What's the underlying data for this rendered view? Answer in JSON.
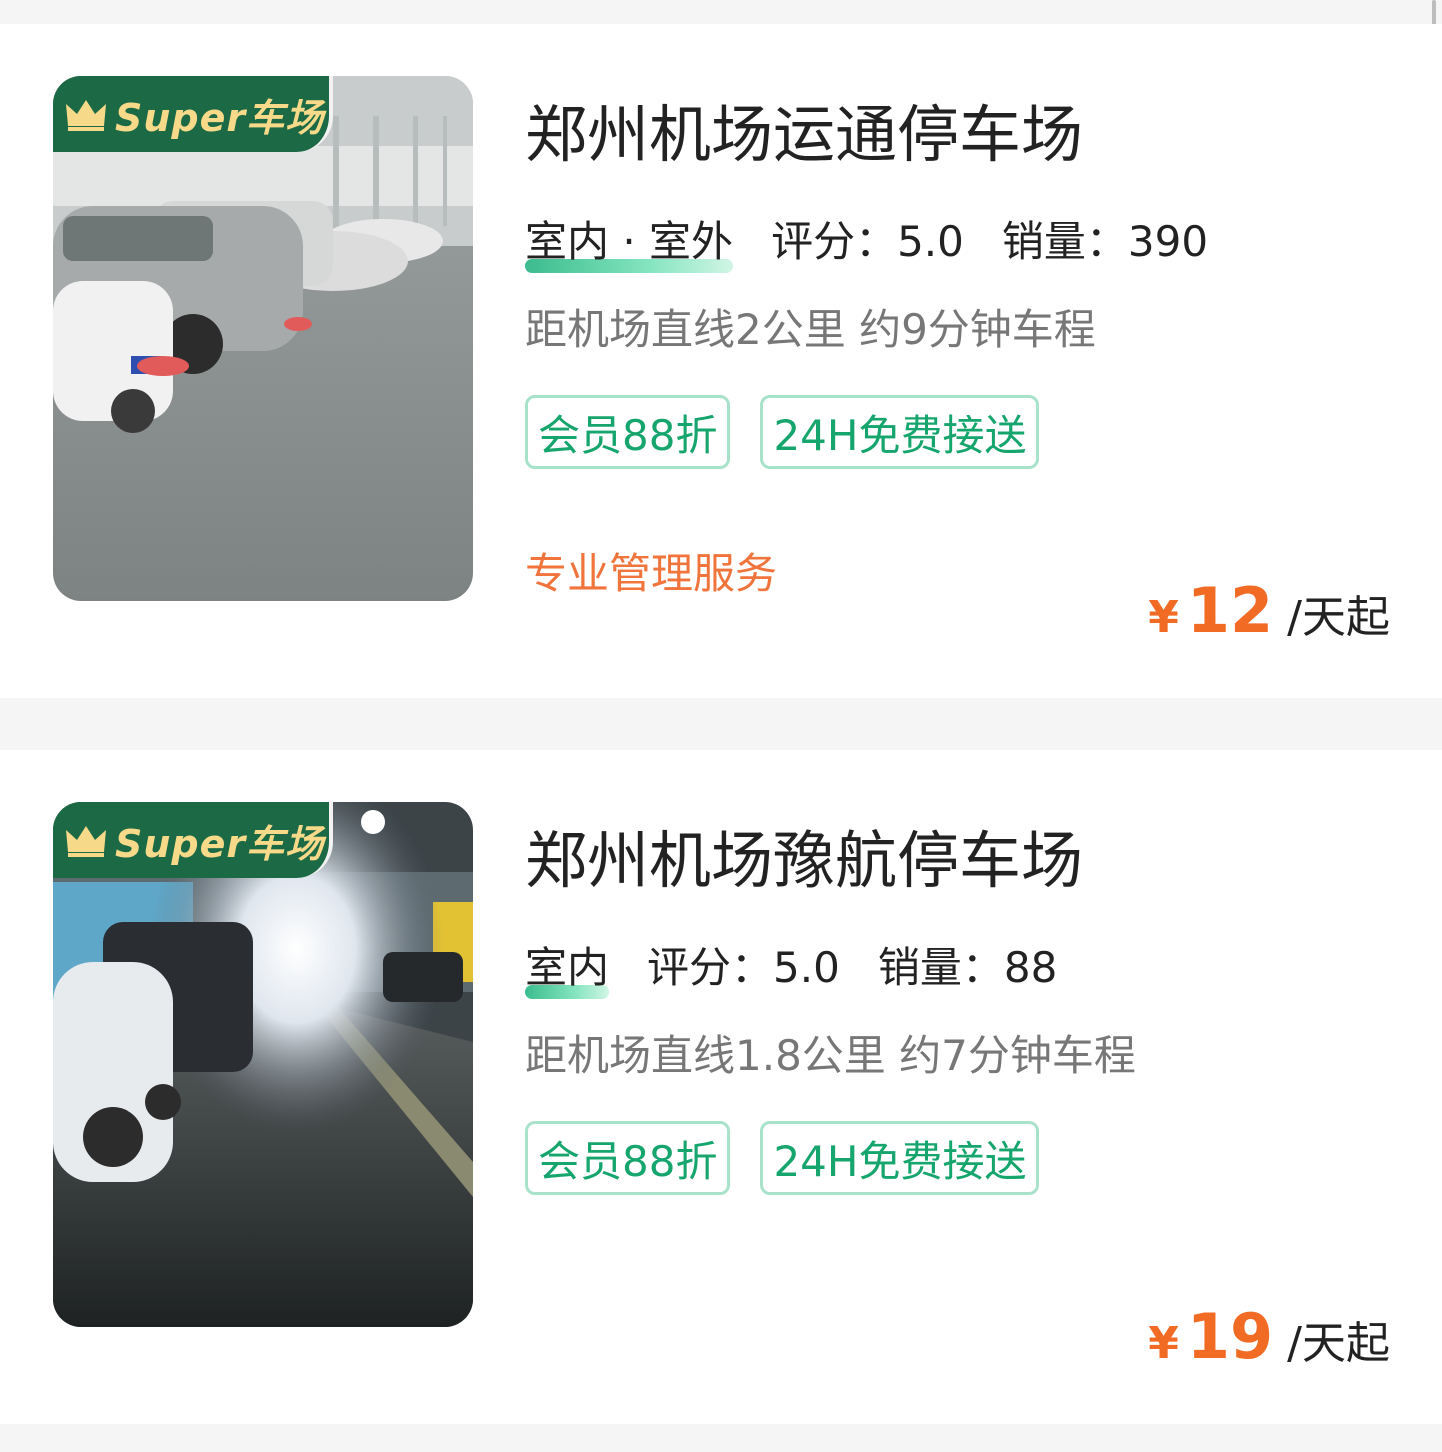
{
  "listings": [
    {
      "badge": "Super车场",
      "name": "郑州机场运通停车场",
      "location_type": "室内 · 室外",
      "rating_label": "评分：",
      "rating": "5.0",
      "sales_label": "销量：",
      "sales": "390",
      "distance": "距机场直线2公里 约9分钟车程",
      "tags": [
        "会员88折",
        "24H免费接送"
      ],
      "service": "专业管理服务",
      "currency": "¥",
      "price": "12",
      "price_unit": "/天起"
    },
    {
      "badge": "Super车场",
      "name": "郑州机场豫航停车场",
      "location_type": "室内",
      "rating_label": "评分：",
      "rating": "5.0",
      "sales_label": "销量：",
      "sales": "88",
      "distance": "距机场直线1.8公里 约7分钟车程",
      "tags": [
        "会员88折",
        "24H免费接送"
      ],
      "service": "",
      "currency": "¥",
      "price": "19",
      "price_unit": "/天起"
    }
  ],
  "colors": {
    "accent_green": "#16a56d",
    "price_orange": "#f26b25",
    "service_orange": "#f0743b",
    "badge_green": "#1c6a45",
    "badge_gold": "#f6d989"
  }
}
